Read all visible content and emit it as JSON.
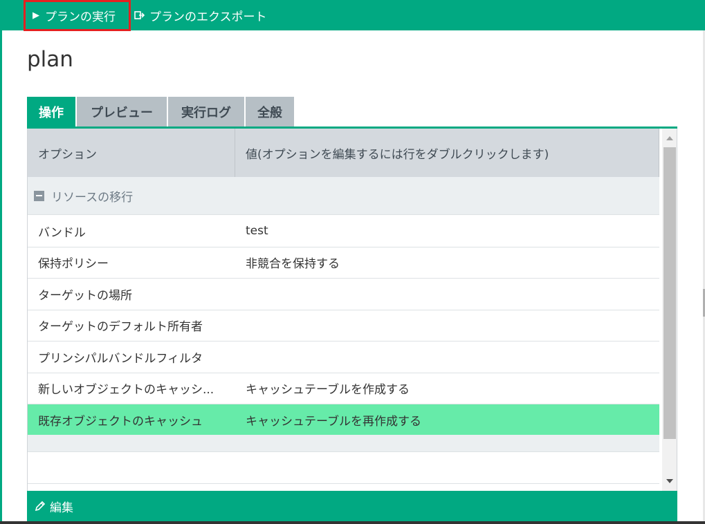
{
  "toolbar": {
    "run_plan_label": "プランの実行",
    "run_icon": "play-icon",
    "export_plan_label": "プランのエクスポート",
    "export_icon": "export-icon"
  },
  "page": {
    "title": "plan"
  },
  "tabs": [
    {
      "label": "操作",
      "active": true
    },
    {
      "label": "プレビュー",
      "active": false
    },
    {
      "label": "実行ログ",
      "active": false
    },
    {
      "label": "全般",
      "active": false
    }
  ],
  "grid": {
    "headers": {
      "option": "オプション",
      "value": "値(オプションを編集するには行をダブルクリックします)"
    },
    "group": {
      "label": "リソースの移行",
      "collapse_icon": "minus-icon"
    },
    "rows": [
      {
        "option": "バンドル",
        "value": "test"
      },
      {
        "option": "保持ポリシー",
        "value": "非競合を保持する"
      },
      {
        "option": "ターゲットの場所",
        "value": ""
      },
      {
        "option": "ターゲットのデフォルト所有者",
        "value": ""
      },
      {
        "option": "プリンシパルバンドルフィルタ",
        "value": ""
      },
      {
        "option": "新しいオブジェクトのキャッシ...",
        "value": "キャッシュテーブルを作成する"
      },
      {
        "option": "既存オブジェクトのキャッシュ",
        "value": "キャッシュテーブルを再作成する"
      }
    ],
    "selected_row_index": 6
  },
  "footer": {
    "edit_label": "編集",
    "edit_icon": "pencil-icon"
  },
  "colors": {
    "brand": "#01a982",
    "selected_row": "#66eba9",
    "highlight_border": "#e52020"
  }
}
